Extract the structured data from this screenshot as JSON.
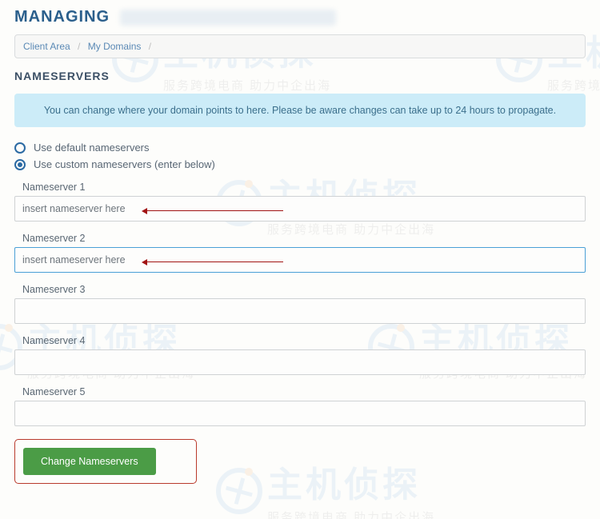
{
  "heading_prefix": "MANAGING",
  "breadcrumb": {
    "items": [
      "Client Area",
      "My Domains"
    ],
    "sep": "/"
  },
  "section_title": "NAMESERVERS",
  "alert": "You can change where your domain points to here. Please be aware changes can take up to 24 hours to propagate.",
  "radio": {
    "default_label": "Use default nameservers",
    "custom_label": "Use custom nameservers (enter below)",
    "selected": "custom"
  },
  "nameservers": {
    "ns1": {
      "label": "Nameserver 1",
      "value": "insert nameserver here"
    },
    "ns2": {
      "label": "Nameserver 2",
      "value": "insert nameserver here"
    },
    "ns3": {
      "label": "Nameserver 3",
      "value": ""
    },
    "ns4": {
      "label": "Nameserver 4",
      "value": ""
    },
    "ns5": {
      "label": "Nameserver 5",
      "value": ""
    }
  },
  "submit_label": "Change Nameservers",
  "watermark": {
    "main": "主机侦探",
    "sub": "服务跨境电商 助力中企出海"
  }
}
